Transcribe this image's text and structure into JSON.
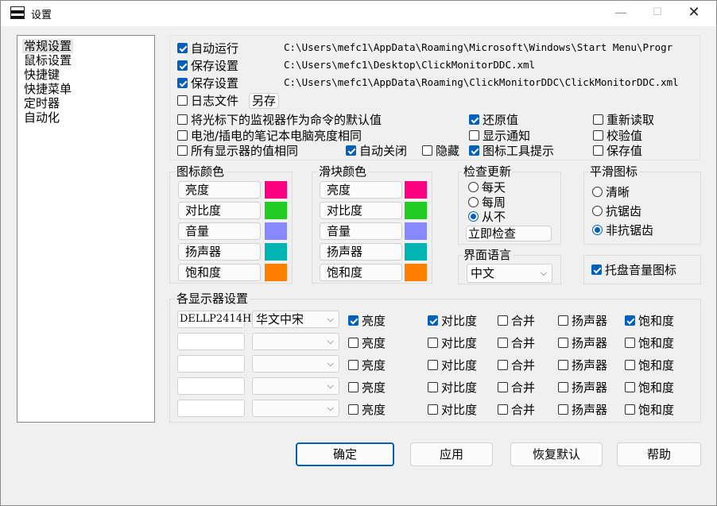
{
  "window": {
    "title": "设置"
  },
  "nav": {
    "items": [
      "常规设置",
      "鼠标设置",
      "快捷键",
      "快捷菜单",
      "定时器",
      "自动化"
    ],
    "selected": 0
  },
  "general": {
    "autorun": {
      "label": "自动运行",
      "checked": true,
      "path": "C:\\Users\\mefc1\\AppData\\Roaming\\Microsoft\\Windows\\Start Menu\\Progr"
    },
    "save1": {
      "label": "保存设置",
      "checked": true,
      "path": "C:\\Users\\mefc1\\Desktop\\ClickMonitorDDC.xml"
    },
    "save2": {
      "label": "保存设置",
      "checked": true,
      "path": "C:\\Users\\mefc1\\AppData\\Roaming\\ClickMonitorDDC\\ClickMonitorDDC.xml"
    },
    "logfile": {
      "label": "日志文件",
      "checked": false,
      "saveas": "另存"
    }
  },
  "options": {
    "cursor_monitor": {
      "label": "将光标下的监视器作为命令的默认值",
      "checked": false
    },
    "battery_same": {
      "label": "电池/插电的笔记本电脑亮度相同",
      "checked": false
    },
    "all_same": {
      "label": "所有显示器的值相同",
      "checked": false
    },
    "auto_close": {
      "label": "自动关闭",
      "checked": true
    },
    "hide": {
      "label": "隐藏",
      "checked": false
    },
    "restore": {
      "label": "还原值",
      "checked": true
    },
    "show_notify": {
      "label": "显示通知",
      "checked": false
    },
    "tooltip": {
      "label": "图标工具提示",
      "checked": true
    },
    "reread": {
      "label": "重新读取",
      "checked": false
    },
    "calib": {
      "label": "校验值",
      "checked": false
    },
    "keep": {
      "label": "保存值",
      "checked": false
    }
  },
  "icon_colors": {
    "title": "图标颜色",
    "items": [
      {
        "label": "亮度",
        "color": "#ff0080"
      },
      {
        "label": "对比度",
        "color": "#22cc22"
      },
      {
        "label": "音量",
        "color": "#8888ff"
      },
      {
        "label": "扬声器",
        "color": "#00b4b4"
      },
      {
        "label": "饱和度",
        "color": "#ff8000"
      }
    ]
  },
  "slider_colors": {
    "title": "滑块颜色",
    "items": [
      {
        "label": "亮度",
        "color": "#ff0080"
      },
      {
        "label": "对比度",
        "color": "#22cc22"
      },
      {
        "label": "音量",
        "color": "#8888ff"
      },
      {
        "label": "扬声器",
        "color": "#00b4b4"
      },
      {
        "label": "饱和度",
        "color": "#ff8000"
      }
    ]
  },
  "update": {
    "title": "检查更新",
    "options": [
      "每天",
      "每周",
      "从不"
    ],
    "selected": 2,
    "check_now": "立即检查"
  },
  "smooth": {
    "title": "平滑图标",
    "options": [
      "清晰",
      "抗锯齿",
      "非抗锯齿"
    ],
    "selected": 2
  },
  "language": {
    "title": "界面语言",
    "value": "中文"
  },
  "tray": {
    "label": "托盘音量图标",
    "checked": true
  },
  "monitors": {
    "title": "各显示器设置",
    "headers": [
      "亮度",
      "对比度",
      "合并",
      "扬声器",
      "饱和度"
    ],
    "rows": [
      {
        "name": "DELLP2414H",
        "font": "华文中宋",
        "checks": [
          true,
          true,
          false,
          false,
          true
        ]
      },
      {
        "name": "",
        "font": "",
        "checks": [
          false,
          false,
          false,
          false,
          false
        ]
      },
      {
        "name": "",
        "font": "",
        "checks": [
          false,
          false,
          false,
          false,
          false
        ]
      },
      {
        "name": "",
        "font": "",
        "checks": [
          false,
          false,
          false,
          false,
          false
        ]
      },
      {
        "name": "",
        "font": "",
        "checks": [
          false,
          false,
          false,
          false,
          false
        ]
      }
    ]
  },
  "actions": {
    "ok": "确定",
    "apply": "应用",
    "reset": "恢复默认",
    "help": "帮助"
  }
}
